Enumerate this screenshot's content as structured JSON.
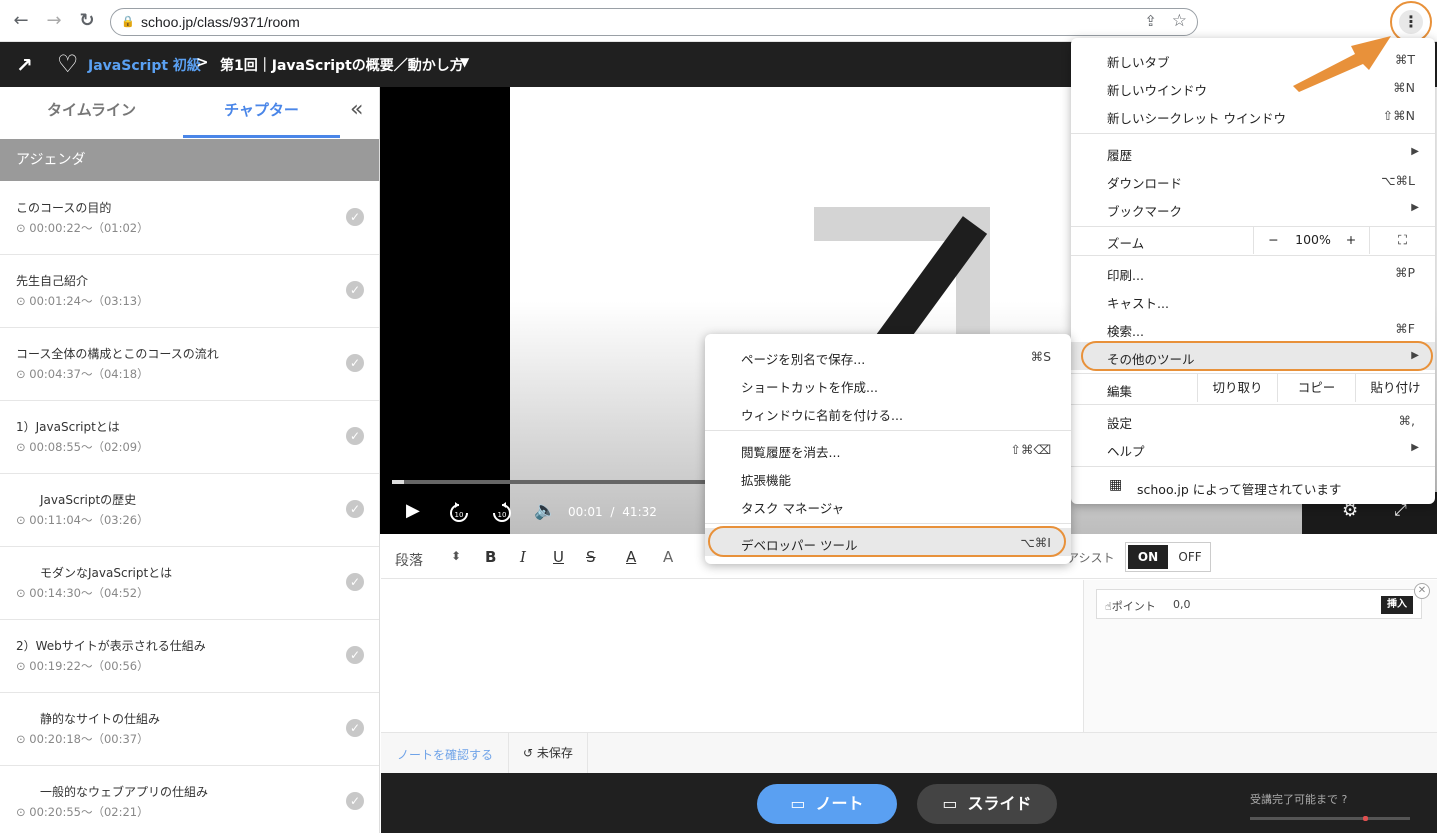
{
  "browser": {
    "url": "schoo.jp/class/9371/room",
    "back_icon": "←",
    "forward_icon": "→",
    "reload_icon": "↻",
    "menu_icon": "⋮"
  },
  "header": {
    "logo": "↗",
    "course_name": "JavaScript 初級",
    "separator": ">",
    "lesson_title": "第1回｜JavaScriptの概要／動かし方"
  },
  "sidebar": {
    "tabs": [
      "タイムライン",
      "チャプター"
    ],
    "active_tab": "チャプター",
    "collapse_icon": "«",
    "agenda_label": "アジェンダ",
    "chapters": [
      {
        "title": "このコースの目的",
        "time": "00:00:22〜（01:02）",
        "indent": false
      },
      {
        "title": "先生自己紹介",
        "time": "00:01:24〜（03:13）",
        "indent": false
      },
      {
        "title": "コース全体の構成とこのコースの流れ",
        "time": "00:04:37〜（04:18）",
        "indent": false
      },
      {
        "title": "1）JavaScriptとは",
        "time": "00:08:55〜（02:09）",
        "indent": false
      },
      {
        "title": "JavaScriptの歴史",
        "time": "00:11:04〜（03:26）",
        "indent": true
      },
      {
        "title": "モダンなJavaScriptとは",
        "time": "00:14:30〜（04:52）",
        "indent": true
      },
      {
        "title": "2）Webサイトが表示される仕組み",
        "time": "00:19:22〜（00:56）",
        "indent": false
      },
      {
        "title": "静的なサイトの仕組み",
        "time": "00:20:18〜（00:37）",
        "indent": true
      },
      {
        "title": "一般的なウェブアプリの仕組み",
        "time": "00:20:55〜（02:21）",
        "indent": true
      }
    ]
  },
  "player": {
    "current_time": "00:01",
    "duration": "41:32",
    "time_separator": "/",
    "progress_fraction": 0.012
  },
  "editor": {
    "paragraph_label": "段落",
    "assist_label": "アシスト",
    "toggle_on": "ON",
    "toggle_off": "OFF",
    "point_label": "ポイント",
    "point_value": "0,0",
    "insert_label": "挿入",
    "confirm_note": "ノートを確認する",
    "unsaved": "未保存"
  },
  "bottom": {
    "note_button": "ノート",
    "slide_button": "スライド",
    "completion_label": "受講完了可能まで"
  },
  "chrome_menu": {
    "new_tab": "新しいタブ",
    "new_tab_sc": "⌘T",
    "new_window": "新しいウインドウ",
    "new_window_sc": "⌘N",
    "new_incognito": "新しいシークレット ウインドウ",
    "new_incognito_sc": "⇧⌘N",
    "history": "履歴",
    "downloads": "ダウンロード",
    "downloads_sc": "⌥⌘L",
    "bookmarks": "ブックマーク",
    "zoom": "ズーム",
    "zoom_minus": "−",
    "zoom_level": "100%",
    "zoom_plus": "+",
    "print": "印刷...",
    "print_sc": "⌘P",
    "cast": "キャスト...",
    "find": "検索...",
    "find_sc": "⌘F",
    "more_tools": "その他のツール",
    "edit": "編集",
    "cut": "切り取り",
    "copy": "コピー",
    "paste": "貼り付け",
    "settings": "設定",
    "settings_sc": "⌘,",
    "help": "ヘルプ",
    "managed": "schoo.jp によって管理されています"
  },
  "more_tools_menu": {
    "save_page": "ページを別名で保存...",
    "save_page_sc": "⌘S",
    "create_shortcut": "ショートカットを作成...",
    "name_window": "ウィンドウに名前を付ける...",
    "clear_history": "閲覧履歴を消去...",
    "clear_history_sc": "⇧⌘⌫",
    "extensions": "拡張機能",
    "task_manager": "タスク マネージャ",
    "dev_tools": "デベロッパー ツール",
    "dev_tools_sc": "⌥⌘I"
  },
  "colors": {
    "accent": "#4a86e8",
    "highlight_ring": "#e8913a",
    "header_bg": "#202020"
  }
}
